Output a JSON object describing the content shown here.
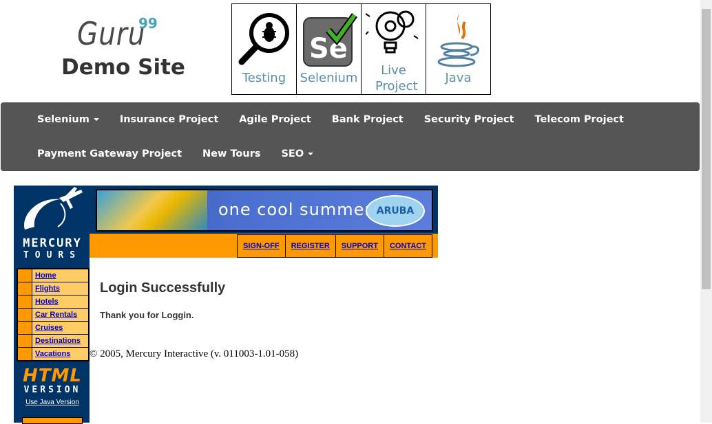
{
  "header": {
    "logo_text": "Guru",
    "logo_superscript": "99",
    "site_title": "Demo Site",
    "tiles": [
      {
        "label": "Testing",
        "icon": "bug-magnifier-icon"
      },
      {
        "label": "Selenium",
        "icon": "selenium-icon"
      },
      {
        "label": "Live Project",
        "icon": "gear-bulb-icon"
      },
      {
        "label": "Java",
        "icon": "java-icon"
      }
    ]
  },
  "navbar": {
    "row1": [
      "Selenium",
      "Insurance Project",
      "Agile Project",
      "Bank Project",
      "Security Project",
      "Telecom Project"
    ],
    "row2": [
      "Payment Gateway Project",
      "New Tours",
      "SEO"
    ]
  },
  "mercury": {
    "brand_line1": "MERCURY",
    "brand_line2": "TOURS",
    "menu": [
      "Home",
      "Flights",
      "Hotels",
      "Car Rentals",
      "Cruises",
      "Destinations",
      "Vacations"
    ],
    "html_logo_line1": "HTML",
    "html_logo_line2": "VERSION",
    "java_link": "Use Java Version",
    "banner_text": "one cool summer",
    "banner_badge": "ARUBA",
    "top_links": [
      "SIGN-OFF",
      "REGISTER",
      "SUPPORT",
      "CONTACT"
    ]
  },
  "main": {
    "title": "Login Successfully",
    "message": "Thank you for Loggin.",
    "copyright": "© 2005, Mercury Interactive (v. 011003-1.01-058)"
  },
  "colors": {
    "navbar_bg": "#555555",
    "mercury_blue": "#003366",
    "mercury_orange": "#ff9900",
    "link_blue": "#0000cc"
  }
}
